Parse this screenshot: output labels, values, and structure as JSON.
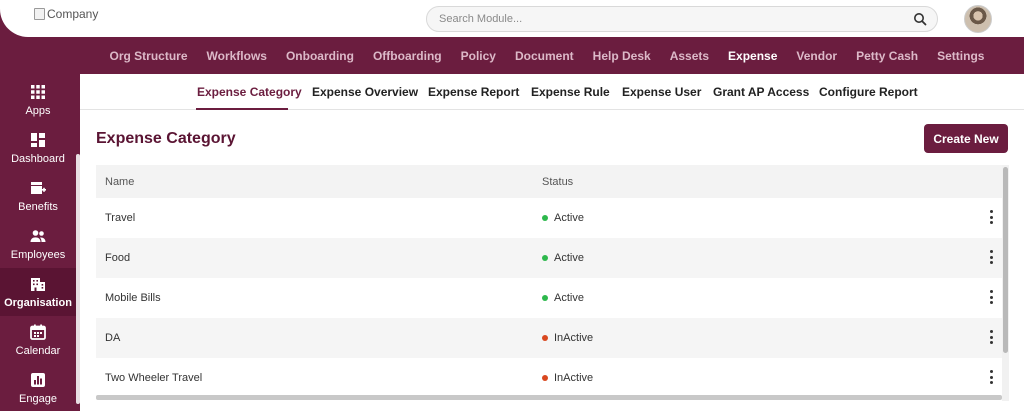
{
  "header": {
    "logo_alt": "Company",
    "search_placeholder": "Search Module...",
    "avatar": "user-avatar"
  },
  "main_nav": [
    {
      "label": "Org Structure"
    },
    {
      "label": "Workflows"
    },
    {
      "label": "Onboarding"
    },
    {
      "label": "Offboarding"
    },
    {
      "label": "Policy"
    },
    {
      "label": "Document"
    },
    {
      "label": "Help Desk"
    },
    {
      "label": "Assets"
    },
    {
      "label": "Expense",
      "active": true
    },
    {
      "label": "Vendor"
    },
    {
      "label": "Petty Cash"
    },
    {
      "label": "Settings"
    }
  ],
  "sidebar": [
    {
      "label": "Apps",
      "icon": "apps-grid-icon"
    },
    {
      "label": "Dashboard",
      "icon": "dashboard-icon"
    },
    {
      "label": "Benefits",
      "icon": "benefits-icon"
    },
    {
      "label": "Employees",
      "icon": "employees-icon"
    },
    {
      "label": "Organisation",
      "icon": "organisation-icon",
      "active": true
    },
    {
      "label": "Calendar",
      "icon": "calendar-icon"
    },
    {
      "label": "Engage",
      "icon": "engage-icon"
    }
  ],
  "subtabs": [
    {
      "label": "Expense Category",
      "active": true
    },
    {
      "label": "Expense Overview"
    },
    {
      "label": "Expense Report"
    },
    {
      "label": "Expense Rule"
    },
    {
      "label": "Expense User"
    },
    {
      "label": "Grant AP Access"
    },
    {
      "label": "Configure Report"
    }
  ],
  "page": {
    "title": "Expense Category",
    "create_button": "Create New"
  },
  "table": {
    "columns": [
      "Name",
      "Status"
    ],
    "rows": [
      {
        "name": "Travel",
        "status": "Active"
      },
      {
        "name": "Food",
        "status": "Active"
      },
      {
        "name": "Mobile Bills",
        "status": "Active"
      },
      {
        "name": "DA",
        "status": "InActive"
      },
      {
        "name": "Two Wheeler Travel",
        "status": "InActive"
      }
    ]
  },
  "colors": {
    "brand": "#6b1d3f",
    "active_status": "#2db84c",
    "inactive_status": "#d9481f"
  }
}
